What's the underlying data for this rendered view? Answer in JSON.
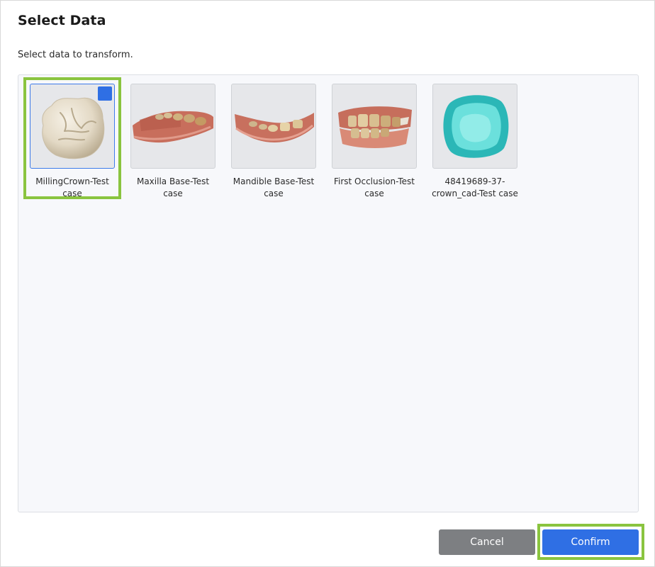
{
  "dialog": {
    "title": "Select Data",
    "subtitle": "Select data to transform."
  },
  "items": [
    {
      "line1": "MillingCrown-Test",
      "line2": "case",
      "selected": true,
      "thumbnail": "crown-model"
    },
    {
      "line1": "Maxilla Base-Test",
      "line2": "case",
      "selected": false,
      "thumbnail": "maxilla-scan"
    },
    {
      "line1": "Mandible Base-Test",
      "line2": "case",
      "selected": false,
      "thumbnail": "mandible-scan"
    },
    {
      "line1": "First Occlusion-Test",
      "line2": "case",
      "selected": false,
      "thumbnail": "occlusion-scan"
    },
    {
      "line1": "48419689-37-",
      "line2": "crown_cad-Test case",
      "selected": false,
      "thumbnail": "crown-cad-model"
    }
  ],
  "buttons": {
    "cancel": "Cancel",
    "confirm": "Confirm"
  },
  "colors": {
    "accent": "#2f6fe4",
    "highlight": "#8ac43f",
    "cancel": "#7d7f82"
  }
}
